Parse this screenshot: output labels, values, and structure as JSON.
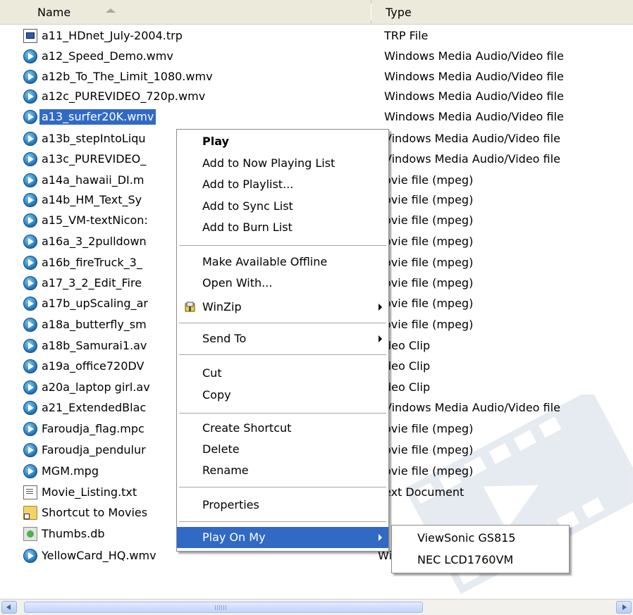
{
  "header": {
    "name_label": "Name",
    "type_label": "Type"
  },
  "files": [
    {
      "name": "a11_HDnet_July-2004.trp",
      "type": "TRP File",
      "icon": "trp-file-icon"
    },
    {
      "name": "a12_Speed_Demo.wmv",
      "type": "Windows Media Audio/Video file",
      "icon": "media-player-icon"
    },
    {
      "name": "a12b_To_The_Limit_1080.wmv",
      "type": "Windows Media Audio/Video file",
      "icon": "media-player-icon"
    },
    {
      "name": "a12c_PUREVIDEO_720p.wmv",
      "type": "Windows Media Audio/Video file",
      "icon": "media-player-icon"
    },
    {
      "name": "a13_surfer20K.wmv",
      "type": "Windows Media Audio/Video file",
      "icon": "media-player-icon",
      "selected": true
    },
    {
      "name": "a13b_stepIntoLiqu",
      "type": "Vindows Media Audio/Video file",
      "icon": "media-player-icon"
    },
    {
      "name": "a13c_PUREVIDEO_",
      "type": "Vindows Media Audio/Video file",
      "icon": "media-player-icon"
    },
    {
      "name": "a14a_hawaii_DI.m",
      "type": "ovie file (mpeg)",
      "icon": "media-player-icon"
    },
    {
      "name": "a14b_HM_Text_Sy",
      "type": "ovie file (mpeg)",
      "icon": "media-player-icon"
    },
    {
      "name": "a15_VM-textNicon:",
      "type": "ovie file (mpeg)",
      "icon": "media-player-icon"
    },
    {
      "name": "a16a_3_2pulldown",
      "type": "ovie file (mpeg)",
      "icon": "media-player-icon"
    },
    {
      "name": "a16b_fireTruck_3_",
      "type": "ovie file (mpeg)",
      "icon": "media-player-icon"
    },
    {
      "name": "a17_3_2_Edit_Fire",
      "type": "ovie file (mpeg)",
      "icon": "media-player-icon"
    },
    {
      "name": "a17b_upScaling_ar",
      "type": "ovie file (mpeg)",
      "icon": "media-player-icon"
    },
    {
      "name": "a18a_butterfly_sm",
      "type": "ovie file (mpeg)",
      "icon": "media-player-icon"
    },
    {
      "name": "a18b_Samurai1.av",
      "type": "deo Clip",
      "icon": "media-player-icon"
    },
    {
      "name": "a19a_office720DV",
      "type": "deo Clip",
      "icon": "media-player-icon"
    },
    {
      "name": "a20a_laptop girl.av",
      "type": "deo Clip",
      "icon": "media-player-icon"
    },
    {
      "name": "a21_ExtendedBlac",
      "type": "Vindows Media Audio/Video file",
      "icon": "media-player-icon"
    },
    {
      "name": "Faroudja_flag.mpc",
      "type": "ovie file (mpeg)",
      "icon": "media-player-icon"
    },
    {
      "name": "Faroudja_pendulur",
      "type": "ovie file (mpeg)",
      "icon": "media-player-icon"
    },
    {
      "name": "MGM.mpg",
      "type": "ovie file (mpeg)",
      "icon": "media-player-icon"
    },
    {
      "name": "Movie_Listing.txt",
      "type": "ext Document",
      "icon": "text-file-icon"
    },
    {
      "name": "Shortcut to Movies",
      "type": "",
      "icon": "folder-shortcut-icon"
    },
    {
      "name": "Thumbs.db",
      "type": "",
      "icon": "database-file-icon"
    },
    {
      "name": "YellowCard_HQ.wmv",
      "type": "Windows Media Audio/Video file",
      "icon": "media-player-icon"
    }
  ],
  "context_menu": {
    "play": "Play",
    "add_now_playing": "Add to Now Playing List",
    "add_playlist": "Add to Playlist...",
    "add_sync": "Add to Sync List",
    "add_burn": "Add to Burn List",
    "make_offline": "Make Available Offline",
    "open_with": "Open With...",
    "winzip": "WinZip",
    "send_to": "Send To",
    "cut": "Cut",
    "copy": "Copy",
    "create_shortcut": "Create Shortcut",
    "delete": "Delete",
    "rename": "Rename",
    "properties": "Properties",
    "play_on_my": "Play On My"
  },
  "submenu": {
    "item1": "ViewSonic GS815",
    "item2": "NEC LCD1760VM"
  },
  "scrollbar": {
    "left_icon": "scroll-left-icon",
    "right_icon": "scroll-right-icon"
  },
  "colors": {
    "selection": "#316ac5",
    "header_bg": "#ebeadb"
  }
}
